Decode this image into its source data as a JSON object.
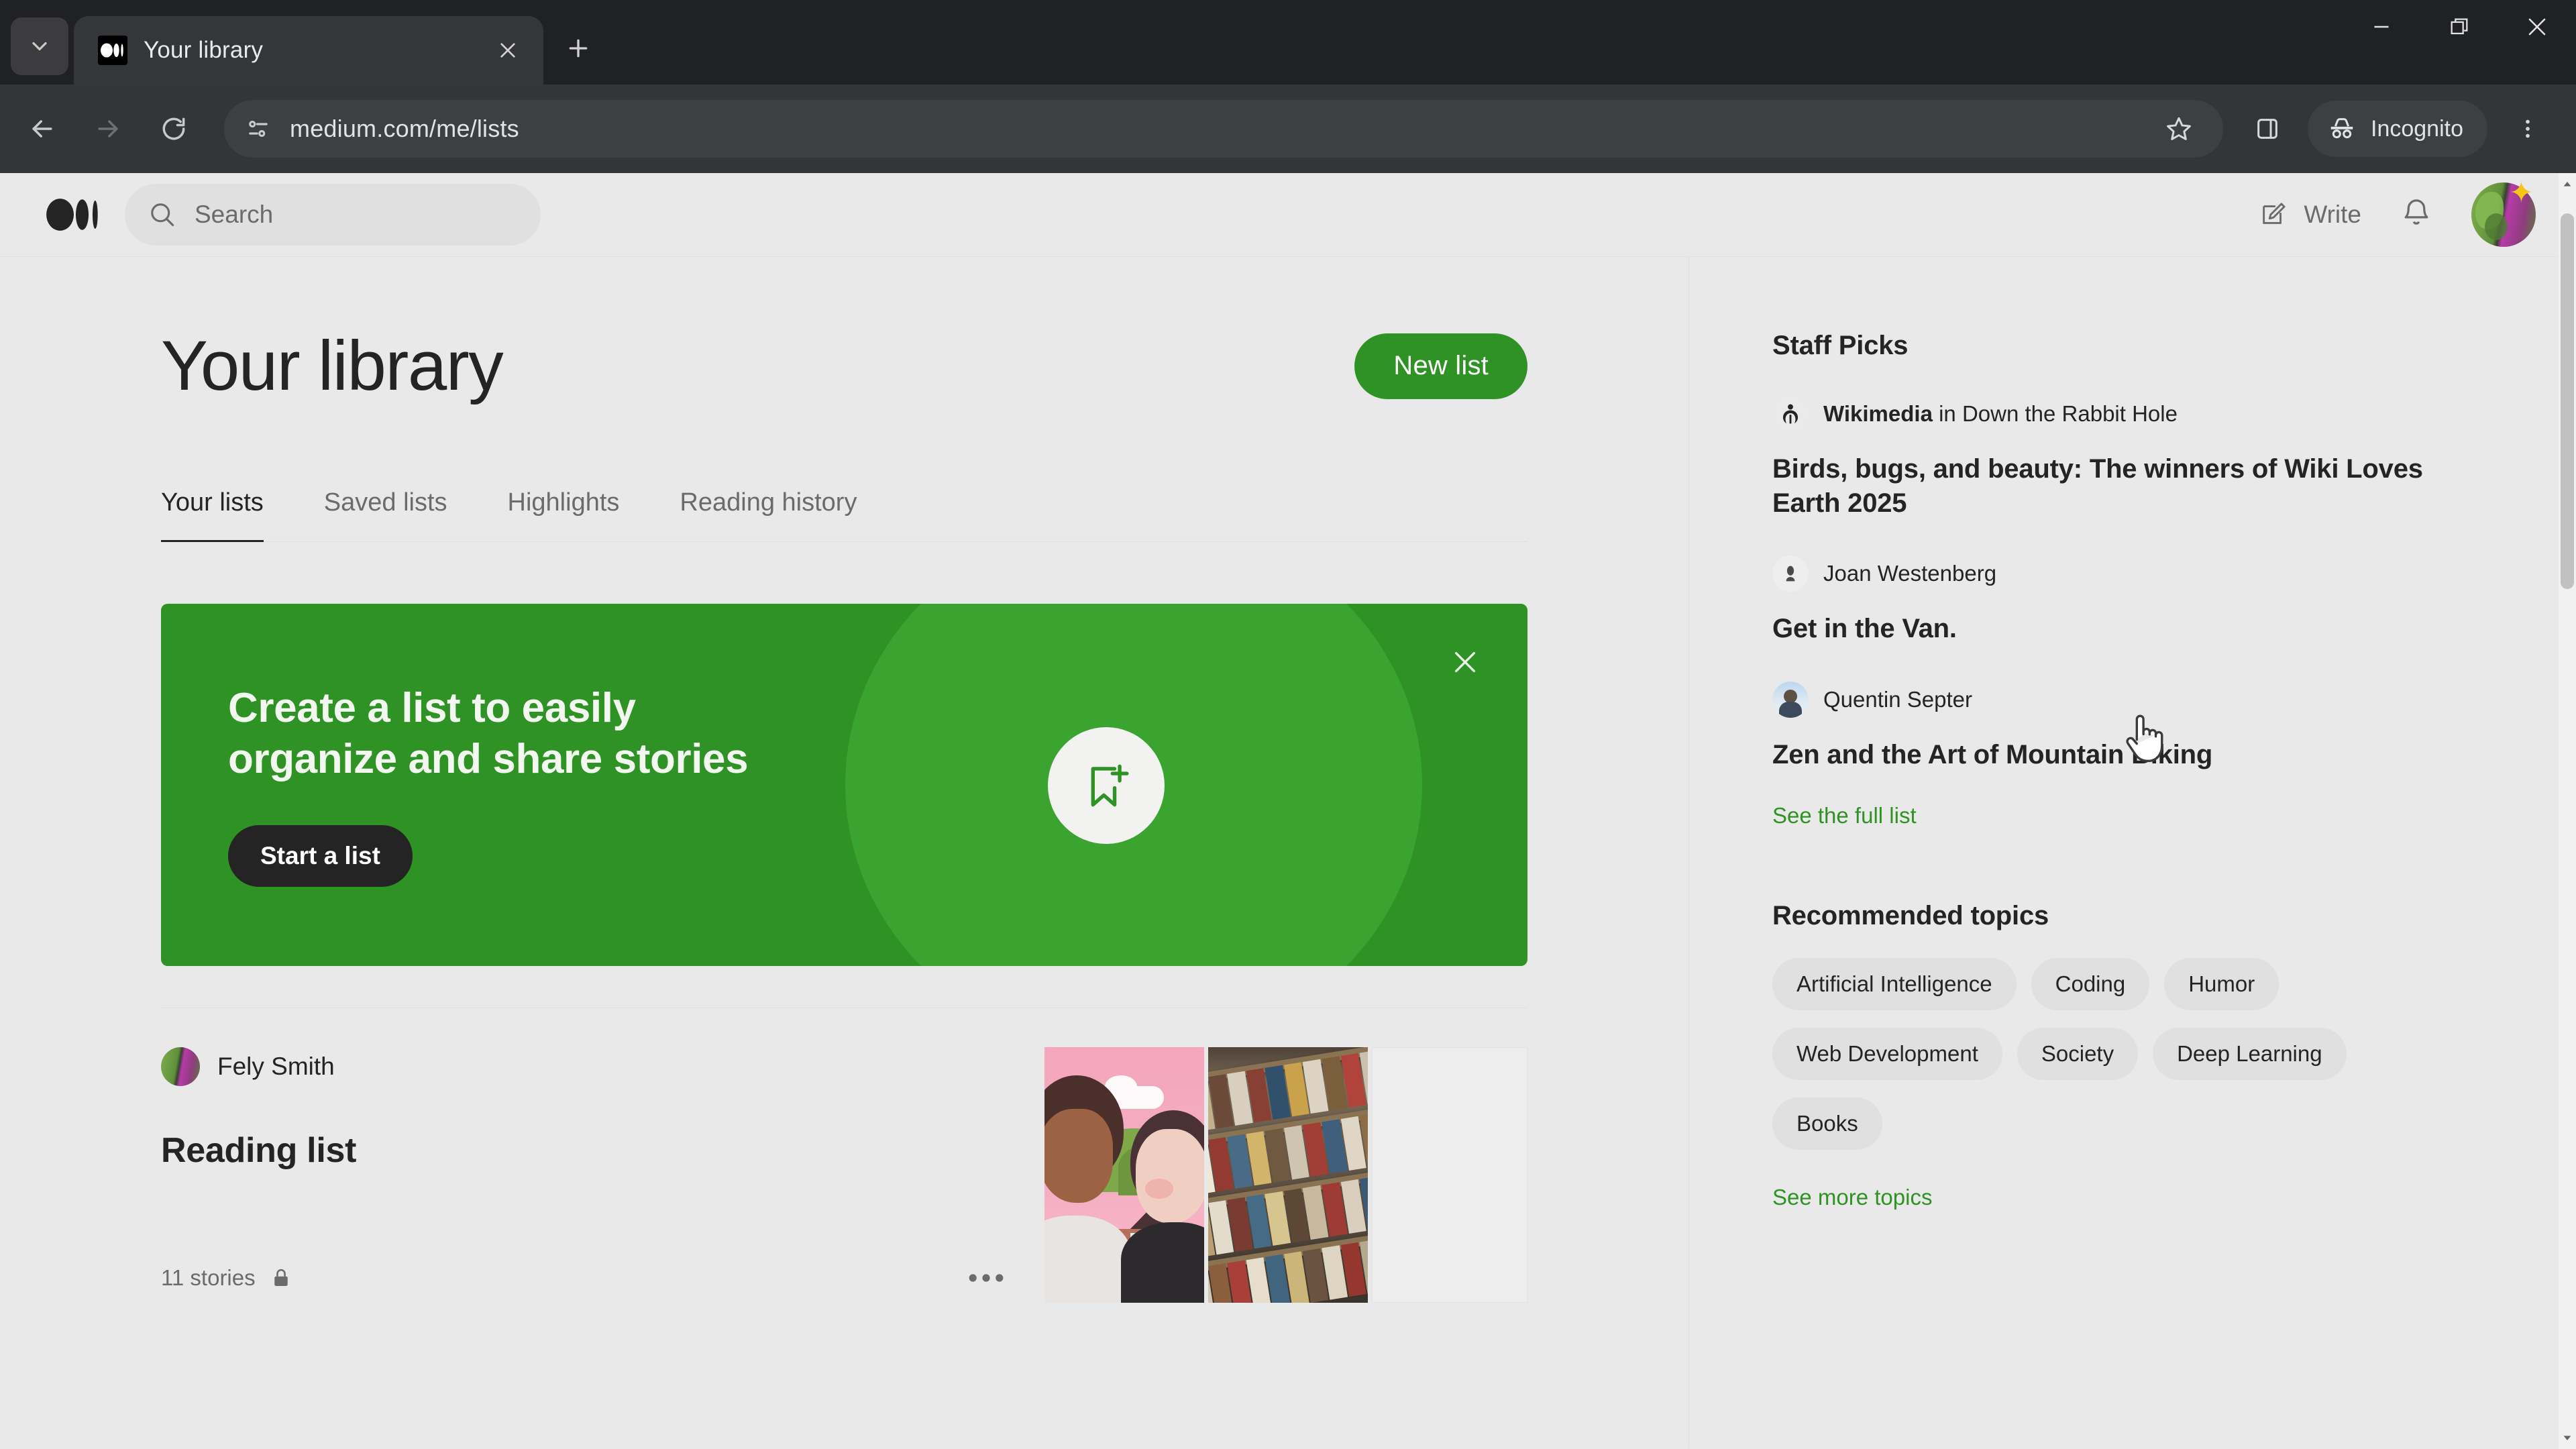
{
  "browser": {
    "tab": {
      "title": "Your library",
      "favicon": "medium-logo-icon"
    },
    "tab_search_icon": "chevron-down-icon",
    "new_tab_icon": "plus-icon",
    "close_tab_icon": "close-icon",
    "window_controls": {
      "minimize": "minimize-icon",
      "maximize": "restore-icon",
      "close": "close-icon"
    },
    "nav": {
      "back": "arrow-left-icon",
      "forward": "arrow-right-icon",
      "reload": "reload-icon"
    },
    "omnibox": {
      "url": "medium.com/me/lists",
      "site_info_icon": "page-info-icon",
      "bookmark_icon": "star-icon"
    },
    "side_panel_icon": "side-panel-icon",
    "incognito_label": "Incognito",
    "incognito_icon": "incognito-icon",
    "menu_icon": "three-dot-menu-icon"
  },
  "header": {
    "logo": "medium-logo-icon",
    "search": {
      "placeholder": "Search",
      "icon": "search-icon"
    },
    "write": {
      "label": "Write",
      "icon": "write-pencil-icon"
    },
    "notifications_icon": "bell-icon",
    "avatar": {
      "name": "user-avatar",
      "badge": "star-badge"
    }
  },
  "main": {
    "title": "Your library",
    "new_list_button": "New list",
    "tabs": [
      {
        "label": "Your lists",
        "active": true
      },
      {
        "label": "Saved lists",
        "active": false
      },
      {
        "label": "Highlights",
        "active": false
      },
      {
        "label": "Reading history",
        "active": false
      }
    ],
    "promo": {
      "heading_line1": "Create a list to easily",
      "heading_line2": "organize and share stories",
      "cta": "Start a list",
      "icon": "bookmark-plus-icon",
      "close_icon": "close-icon",
      "bg_color": "#2e9324",
      "accent_color": "#3ba32f"
    },
    "lists": [
      {
        "author": "Fely Smith",
        "title": "Reading list",
        "stories": "11 stories",
        "privacy_icon": "lock-icon",
        "more_icon": "ellipsis-icon",
        "thumbnails": [
          "illustration-two-people",
          "library-bookshelf",
          "empty-thumb"
        ]
      }
    ]
  },
  "sidebar": {
    "staff_picks_heading": "Staff Picks",
    "picks": [
      {
        "author": "Wikimedia",
        "connector": "in",
        "publication": "Down the Rabbit Hole",
        "title": "Birds, bugs, and beauty: The winners of Wiki Loves Earth 2025",
        "avatar": "wikimedia-logo-icon"
      },
      {
        "author": "Joan Westenberg",
        "connector": "",
        "publication": "",
        "title": "Get in the Van.",
        "avatar": "joan-avatar"
      },
      {
        "author": "Quentin Septer",
        "connector": "",
        "publication": "",
        "title": "Zen and the Art of Mountain Biking",
        "avatar": "quentin-avatar"
      }
    ],
    "see_full_list": "See the full list",
    "topics_heading": "Recommended topics",
    "topics": [
      "Artificial Intelligence",
      "Coding",
      "Humor",
      "Web Development",
      "Society",
      "Deep Learning",
      "Books"
    ],
    "see_more_topics": "See more topics",
    "link_color": "#2e9324"
  }
}
